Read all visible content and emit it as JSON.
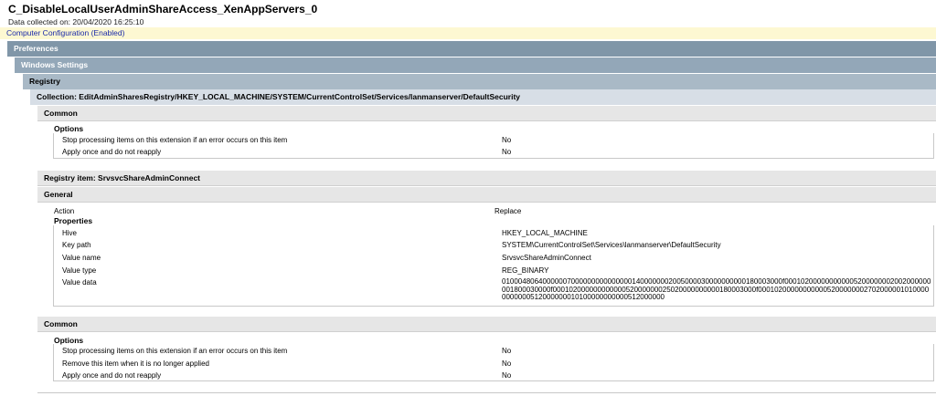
{
  "report": {
    "title": "C_DisableLocalUserAdminShareAccess_XenAppServers_0",
    "data_collected": "Data collected on: 20/04/2020 16:25:10",
    "computer_configuration": "Computer Configuration (Enabled)"
  },
  "sections": {
    "preferences": "Preferences",
    "windows_settings": "Windows Settings",
    "registry": "Registry",
    "collection": "Collection: EditAdminSharesRegistry/HKEY_LOCAL_MACHINE/SYSTEM/CurrentControlSet/Services/lanmanserver/DefaultSecurity"
  },
  "collection_common": {
    "heading": "Common",
    "options_heading": "Options",
    "rows": [
      {
        "label": "Stop processing items on this extension if an error occurs on this item",
        "value": "No"
      },
      {
        "label": "Apply once and do not reapply",
        "value": "No"
      }
    ]
  },
  "registry_item": {
    "heading": "Registry item: SrvsvcShareAdminConnect",
    "general_heading": "General",
    "action_label": "Action",
    "action_value": "Replace",
    "properties_heading": "Properties",
    "properties": [
      {
        "label": "Hive",
        "value": "HKEY_LOCAL_MACHINE"
      },
      {
        "label": "Key path",
        "value": "SYSTEM\\CurrentControlSet\\Services\\lanmanserver\\DefaultSecurity"
      },
      {
        "label": "Value name",
        "value": "SrvsvcShareAdminConnect"
      },
      {
        "label": "Value type",
        "value": "REG_BINARY"
      }
    ],
    "value_data_label": "Value data",
    "value_data": "010004806400000070000000000000001400000002005000030000000000180003000f000102000000000005200000002002000000001800030000f00010200000000000052000000025020000000000180003000f0001020000000000052000000027020000010100000000000512000000010100000000000512000000"
  },
  "item_common": {
    "heading": "Common",
    "options_heading": "Options",
    "rows": [
      {
        "label": "Stop processing items on this extension if an error occurs on this item",
        "value": "No"
      },
      {
        "label": "Remove this item when it is no longer applied",
        "value": "No"
      },
      {
        "label": "Apply once and do not reapply",
        "value": "No"
      }
    ]
  },
  "colors": {
    "preferences_bar": "#8096a8",
    "windows_settings_bar": "#93a7b8",
    "registry_bar": "#a9b9c6",
    "collection_bar": "#d7dee6",
    "subsection_bar": "#e6e6e6",
    "computer_config_bg": "#fdf8d2",
    "computer_config_text": "#1a2aa8"
  }
}
